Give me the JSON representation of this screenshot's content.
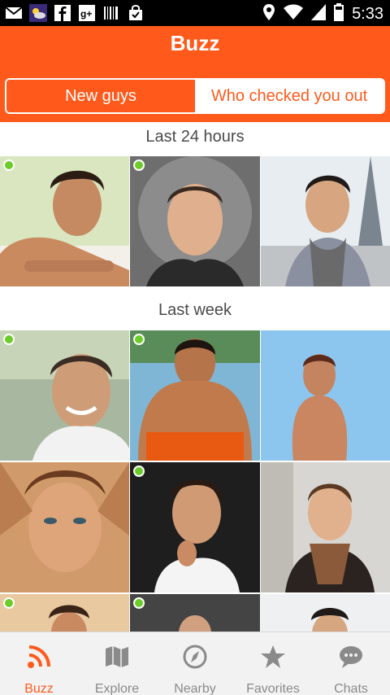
{
  "status_bar": {
    "time": "5:33",
    "left_icons": [
      "gmail-icon",
      "weather-icon",
      "facebook-icon",
      "google-plus-icon",
      "barcode-icon",
      "shopping-bag-icon"
    ],
    "right_icons": [
      "location-icon",
      "wifi-icon",
      "signal-icon",
      "battery-icon"
    ]
  },
  "header": {
    "title": "Buzz"
  },
  "tabs": [
    {
      "label": "New guys",
      "active": true
    },
    {
      "label": "Who checked you out",
      "active": false
    }
  ],
  "sections": [
    {
      "label": "Last 24 hours"
    },
    {
      "label": "Last week"
    }
  ],
  "colors": {
    "accent": "#ff5a1c",
    "online": "#6ccc2a"
  },
  "bottom_nav": [
    {
      "label": "Buzz",
      "icon": "rss-icon",
      "active": true
    },
    {
      "label": "Explore",
      "icon": "map-icon",
      "active": false
    },
    {
      "label": "Nearby",
      "icon": "compass-icon",
      "active": false
    },
    {
      "label": "Favorites",
      "icon": "star-icon",
      "active": false
    },
    {
      "label": "Chats",
      "icon": "chat-bubble-icon",
      "active": false
    }
  ]
}
